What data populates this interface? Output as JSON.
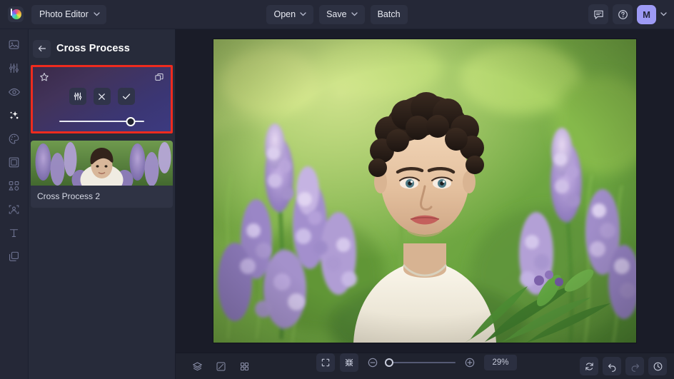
{
  "app": {
    "logo_icon": "colorwheel-logo-icon",
    "menu_label": "Photo Editor",
    "menu_caret": "⌄"
  },
  "topbar": {
    "open_label": "Open",
    "save_label": "Save",
    "batch_label": "Batch",
    "caret": "⌄",
    "feedback_icon": "comment-icon",
    "help_icon": "help-circle-icon",
    "avatar_initial": "M",
    "avatar_caret": "⌄",
    "avatar_color": "#9d9af5"
  },
  "rail": {
    "items": [
      {
        "name": "sidebar-item-image",
        "icon": "image-icon",
        "active": false
      },
      {
        "name": "sidebar-item-adjust",
        "icon": "sliders-icon",
        "active": false
      },
      {
        "name": "sidebar-item-retouch",
        "icon": "eye-icon",
        "active": false
      },
      {
        "name": "sidebar-item-effects",
        "icon": "sparkles-icon",
        "active": true
      },
      {
        "name": "sidebar-item-color",
        "icon": "palette-icon",
        "active": false
      },
      {
        "name": "sidebar-item-frame",
        "icon": "frame-icon",
        "active": false
      },
      {
        "name": "sidebar-item-shapes",
        "icon": "shapes-icon",
        "active": false
      },
      {
        "name": "sidebar-item-portrait",
        "icon": "portrait-select-icon",
        "active": false
      },
      {
        "name": "sidebar-item-text",
        "icon": "text-t-icon",
        "active": false
      },
      {
        "name": "sidebar-item-layers",
        "icon": "layers-stack-icon",
        "active": false
      }
    ]
  },
  "panel": {
    "back_icon": "arrow-left-icon",
    "title": "Cross Process",
    "effect_card": {
      "highlighted": true,
      "highlight_color": "#ee2b1e",
      "favorite_icon": "star-icon",
      "duplicate_icon": "duplicate-icon",
      "settings_icon": "sliders-icon",
      "cancel_icon": "close-x-icon",
      "apply_icon": "check-icon",
      "opacity_percent": 84
    },
    "presets": [
      {
        "label": "Cross Process 2"
      }
    ]
  },
  "canvas": {
    "photo_alt": "portrait-of-man-in-lupine-field"
  },
  "bottombar": {
    "layers_icon": "layers-icon",
    "compare_icon": "compare-split-icon",
    "grid_icon": "grid-view-icon",
    "fit_icon": "fit-screen-icon",
    "shrink_icon": "shrink-icon",
    "zoom_out_icon": "zoom-out-icon",
    "zoom_in_icon": "zoom-in-icon",
    "zoom_value": "29%",
    "zoom_slider_percent": 3,
    "reset_icon": "reset-icon",
    "undo_icon": "undo-icon",
    "redo_icon": "redo-icon",
    "history_icon": "history-icon"
  }
}
